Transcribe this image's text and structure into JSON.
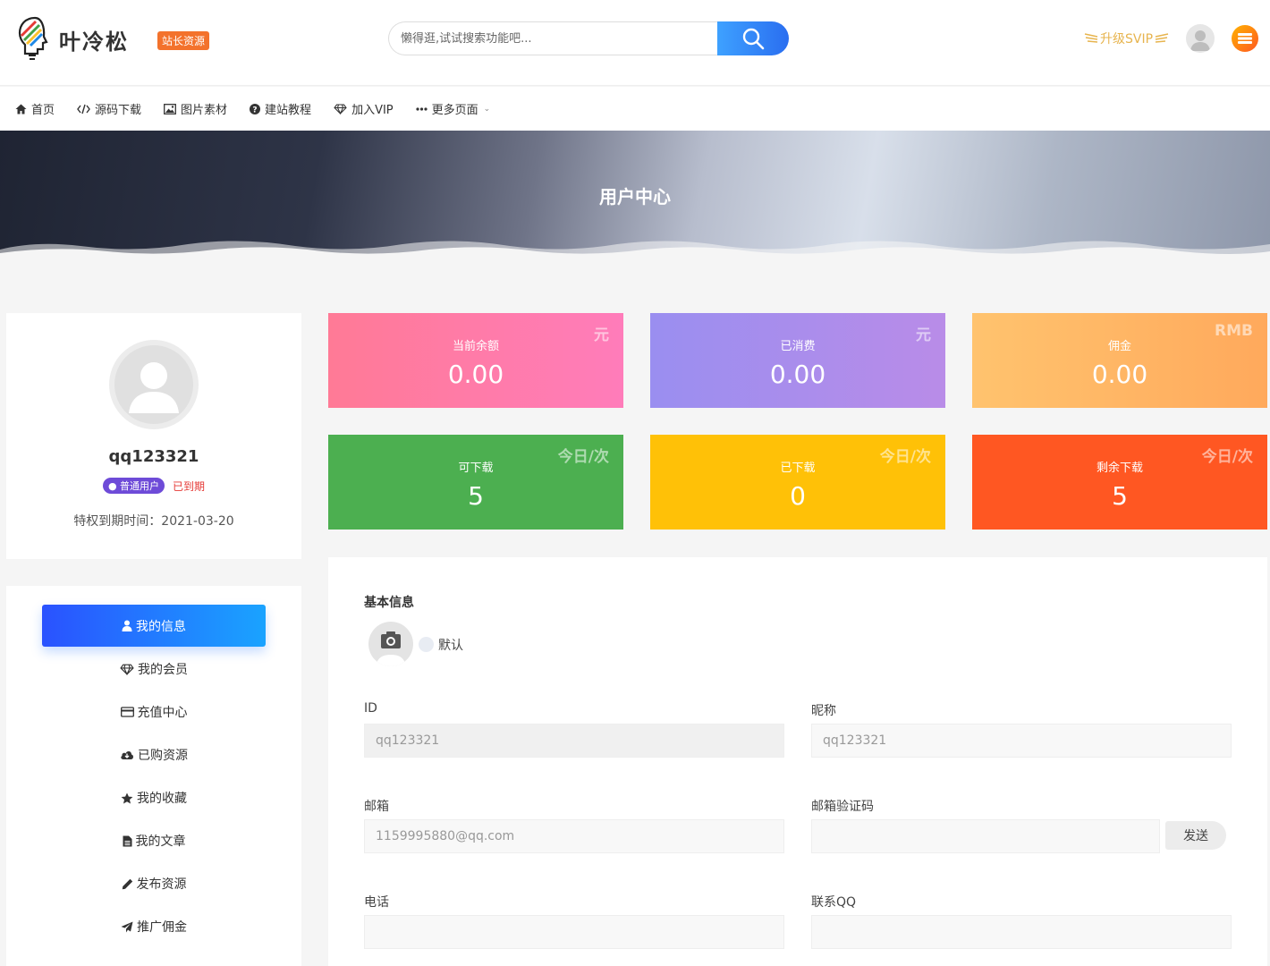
{
  "header": {
    "logo_text": "叶冷松",
    "site_badge": "站长资源",
    "search_placeholder": "懒得逛,试试搜索功能吧...",
    "svip_label": "升级SVIP"
  },
  "nav": {
    "items": [
      {
        "label": "首页",
        "icon": "home-icon"
      },
      {
        "label": "源码下载",
        "icon": "code-icon"
      },
      {
        "label": "图片素材",
        "icon": "image-icon"
      },
      {
        "label": "建站教程",
        "icon": "question-icon"
      },
      {
        "label": "加入VIP",
        "icon": "diamond-icon"
      },
      {
        "label": "更多页面",
        "icon": "ellipsis-icon"
      }
    ]
  },
  "banner": {
    "title": "用户中心"
  },
  "profile": {
    "username": "qq123321",
    "role": "普通用户",
    "status": "已到期",
    "expire_label": "特权到期时间：2021-03-20"
  },
  "side_menu": {
    "active": "我的信息",
    "items": [
      {
        "label": "我的会员",
        "icon": "diamond-icon"
      },
      {
        "label": "充值中心",
        "icon": "credit-card-icon"
      },
      {
        "label": "已购资源",
        "icon": "cloud-download-icon"
      },
      {
        "label": "我的收藏",
        "icon": "star-icon"
      },
      {
        "label": "我的文章",
        "icon": "document-icon"
      },
      {
        "label": "发布资源",
        "icon": "pencil-icon"
      },
      {
        "label": "推广佣金",
        "icon": "paper-plane-icon"
      }
    ]
  },
  "stats": [
    {
      "label": "当前余额",
      "value": "0.00",
      "unit": "元",
      "color_from": "#ff7a96",
      "color_to": "#ff7cba"
    },
    {
      "label": "已消费",
      "value": "0.00",
      "unit": "元",
      "color_from": "#9a8ef0",
      "color_to": "#b98ce8"
    },
    {
      "label": "佣金",
      "value": "0.00",
      "unit": "RMB",
      "color_from": "#ffc36e",
      "color_to": "#ffa95c"
    },
    {
      "label": "可下载",
      "value": "5",
      "unit": "今日/次",
      "color_from": "#4caf50",
      "color_to": "#4caf50"
    },
    {
      "label": "已下载",
      "value": "0",
      "unit": "今日/次",
      "color_from": "#ffc107",
      "color_to": "#ffc107"
    },
    {
      "label": "剩余下载",
      "value": "5",
      "unit": "今日/次",
      "color_from": "#ff5722",
      "color_to": "#ff5722"
    }
  ],
  "form": {
    "section_title": "基本信息",
    "avatar_option": "默认",
    "id_label": "ID",
    "id_value": "qq123321",
    "nickname_label": "昵称",
    "nickname_value": "qq123321",
    "email_label": "邮箱",
    "email_value": "1159995880@qq.com",
    "email_code_label": "邮箱验证码",
    "email_code_value": "",
    "send_label": "发送",
    "phone_label": "电话",
    "phone_value": "",
    "qq_label": "联系QQ",
    "qq_value": ""
  }
}
